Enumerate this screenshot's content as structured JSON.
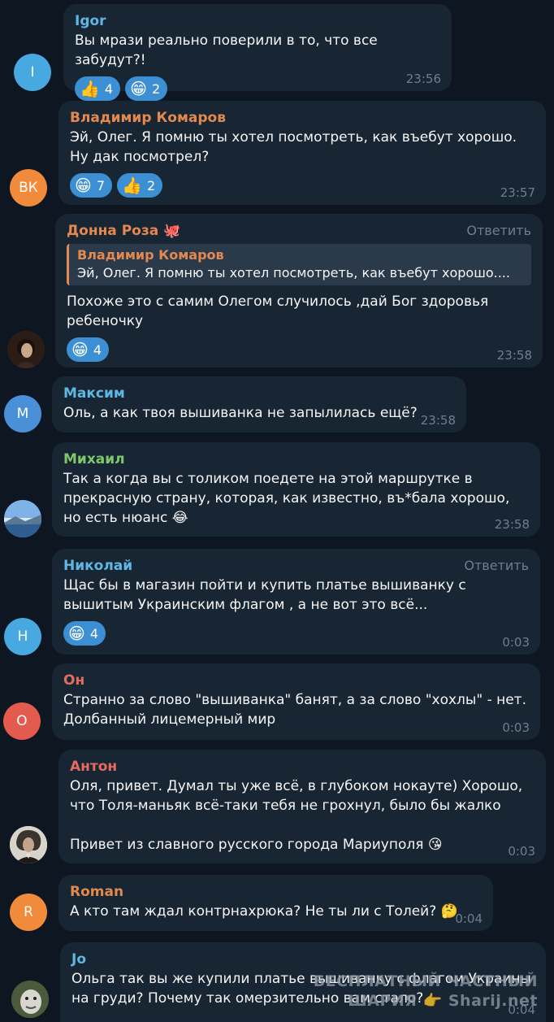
{
  "messages": [
    {
      "author": "Igor",
      "author_color": "#5fb7e3",
      "initial": "I",
      "avatar_color": "#48a9e0",
      "text": "Вы мрази реально поверили в то, что все забудут?!",
      "time": "23:56",
      "reactions": [
        {
          "emoji": "👍",
          "count": "4"
        },
        {
          "emoji": "😁",
          "count": "2"
        }
      ]
    },
    {
      "author": "Владимир Комаров",
      "author_color": "#e3894f",
      "initial": "ВК",
      "avatar_color": "#f28a3b",
      "text": "Эй, Олег. Я помню ты хотел посмотреть, как въебут хорошо. Ну дак посмотрел?",
      "time": "23:57",
      "reactions": [
        {
          "emoji": "😁",
          "count": "7"
        },
        {
          "emoji": "👍",
          "count": "2"
        }
      ]
    },
    {
      "author": "Донна Роза",
      "author_badge": "🐙",
      "author_color": "#e3894f",
      "avatar_icon": "photo-avatar",
      "reply_label": "Ответить",
      "quote": {
        "name": "Владимир Комаров",
        "text": "Эй, Олег. Я помню ты хотел посмотреть, как въебут хорошо...."
      },
      "text": "Похоже это с самим Олегом случилось ,дай Бог здоровья ребеночку",
      "time": "23:58",
      "reactions": [
        {
          "emoji": "😁",
          "count": "4"
        }
      ]
    },
    {
      "author": "Максим",
      "author_color": "#5fb7e3",
      "initial": "М",
      "avatar_color": "#4a90d9",
      "text": "Оль, а как твоя вышиванка не запылилась ещё?",
      "time": "23:58"
    },
    {
      "author": "Михаил",
      "author_color": "#7ec76b",
      "avatar_icon": "landscape-avatar",
      "text": "Так а когда вы с толиком поедете на этой маршрутке в прекрасную страну, которая, как известно, въ*бала хорошо, но есть нюанс 😂",
      "time": "23:58"
    },
    {
      "author": "Николай",
      "author_color": "#5fb7e3",
      "initial": "Н",
      "avatar_color": "#48a9e0",
      "reply_label": "Ответить",
      "text": "Щас бы в магазин пойти и купить платье вышиванку с вышитым Украинским флагом , а не вот это всё...",
      "time": "0:03",
      "reactions": [
        {
          "emoji": "😁",
          "count": "4"
        }
      ]
    },
    {
      "author": "Он",
      "author_color": "#e36b5f",
      "initial": "О",
      "avatar_color": "#e35a4e",
      "text": "Странно за слово \"вышиванка\" банят, а за слово \"хохлы\" - нет. Долбанный лицемерный мир",
      "time": "0:03"
    },
    {
      "author": "Антон",
      "author_color": "#e36b5f",
      "avatar_icon": "portrait-avatar",
      "text": "Оля, привет. Думал ты уже всё, в глубоком нокауте) Хорошо, что Толя-маньяк всё-таки тебя не грохнул, было бы жалко\n\nПривет из славного русского города Мариуполя 😘",
      "time": "0:03"
    },
    {
      "author": "Roman",
      "author_color": "#e3894f",
      "initial": "R",
      "avatar_color": "#f28a3b",
      "text": "А кто там ждал контрнахрюка? Не ты ли с Толей? 🤔",
      "time": "0:04"
    },
    {
      "author": "Jo",
      "author_color": "#5fb7e3",
      "avatar_icon": "animal-avatar",
      "text": "Ольга так вы же купили платье вышиванку с флагом Украины на груди? Почему так омерзительно вам стало?",
      "time": "0:04"
    }
  ],
  "watermark": {
    "line1": "БЕСПЛАТНЫЙ ЧАСТНЫЙ",
    "line2": "ШАРИЯ",
    "hand": "👉",
    "line3": "Sharij.net"
  },
  "colors": {
    "background": "#0e1621",
    "bubble": "#182533",
    "reaction": "#3d8fd3",
    "meta": "#6d7f8f"
  }
}
